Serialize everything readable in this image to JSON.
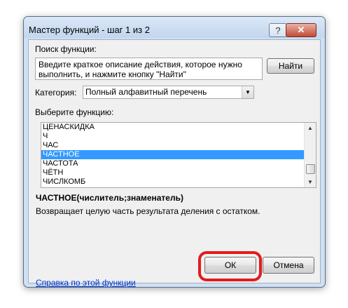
{
  "dialog": {
    "title": "Мастер функций - шаг 1 из 2",
    "help_glyph": "?",
    "close_glyph": "✕"
  },
  "search": {
    "label": "Поиск функции:",
    "description": "Введите краткое описание действия, которое нужно выполнить, и нажмите кнопку \"Найти\"",
    "find_button": "Найти"
  },
  "category": {
    "label": "Категория:",
    "selected": "Полный алфавитный перечень"
  },
  "functions": {
    "label": "Выберите функцию:",
    "items": [
      "ЦЕНАСКИДКА",
      "Ч",
      "ЧАС",
      "ЧАСТНОЕ",
      "ЧАСТОТА",
      "ЧЁТН",
      "ЧИСЛКОМБ"
    ],
    "selected_index": 3
  },
  "selected_function": {
    "signature": "ЧАСТНОЕ(числитель;знаменатель)",
    "description": "Возвращает целую часть результата деления с остатком."
  },
  "footer": {
    "help_link": "Справка по этой функции",
    "ok_button": "ОК",
    "cancel_button": "Отмена"
  },
  "colors": {
    "highlight": "#e31b1b",
    "selection": "#3399ff",
    "link": "#0033cc"
  }
}
